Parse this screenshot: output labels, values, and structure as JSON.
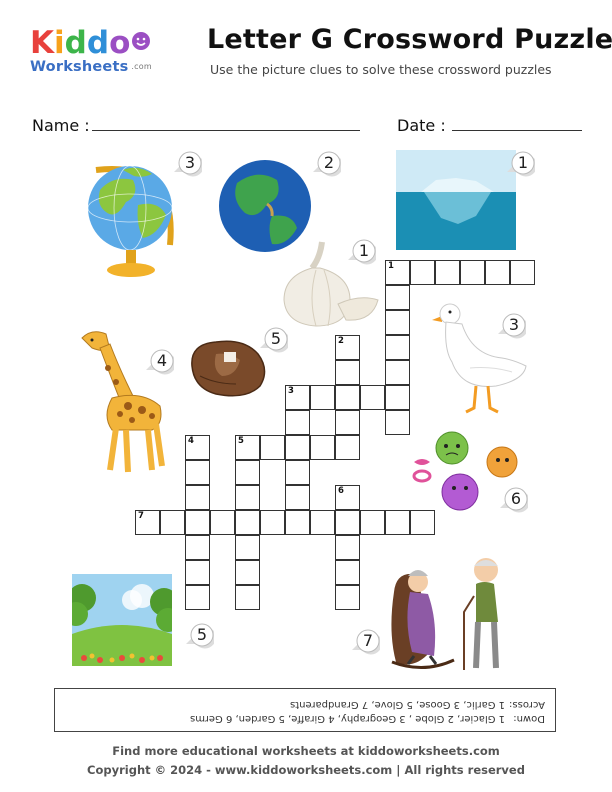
{
  "logo": {
    "letters": [
      "K",
      "i",
      "d",
      "d",
      "o"
    ],
    "letter_colors": [
      "#e8413c",
      "#f7a21b",
      "#3db54a",
      "#2f8fd8",
      "#9b4fc3"
    ],
    "sub": "Worksheets",
    "dotcom": ".com"
  },
  "title": "Letter G Crossword Puzzle",
  "subtitle": "Use the picture clues to solve these crossword puzzles",
  "name_label": "Name :",
  "date_label": "Date :",
  "grid_numbers": {
    "n1": "1",
    "n2": "2",
    "n3": "3",
    "n4": "4",
    "n5": "5",
    "n6": "6",
    "n7": "7"
  },
  "pictures": {
    "globe": {
      "icon": "globe-icon",
      "clue": "3"
    },
    "earth": {
      "icon": "earth-icon",
      "clue": "2"
    },
    "glacier": {
      "icon": "glacier-icon",
      "clue": "1"
    },
    "garlic": {
      "icon": "garlic-icon",
      "clue": "1"
    },
    "goose": {
      "icon": "goose-icon",
      "clue": "3"
    },
    "giraffe": {
      "icon": "giraffe-icon",
      "clue": "4"
    },
    "glove": {
      "icon": "glove-icon",
      "clue": "5"
    },
    "germs": {
      "icon": "germs-icon",
      "clue": "6"
    },
    "garden": {
      "icon": "garden-icon",
      "clue": "5"
    },
    "grandparents": {
      "icon": "grandparents-icon",
      "clue": "7"
    }
  },
  "clues": {
    "down_label": "Down:",
    "down_text": "1 Glacier, 2 Globe , 3 Geography, 4 Giraffe, 5 Garden, 6 Germs",
    "across_label": "Across:",
    "across_text": "1 Garlic, 3 Goose, 5 Glove, 7 Grandparents"
  },
  "footer": {
    "line1": "Find more educational worksheets at kiddoworksheets.com",
    "line2": "Copyright © 2024 - www.kiddoworksheets.com  |  All rights reserved"
  }
}
